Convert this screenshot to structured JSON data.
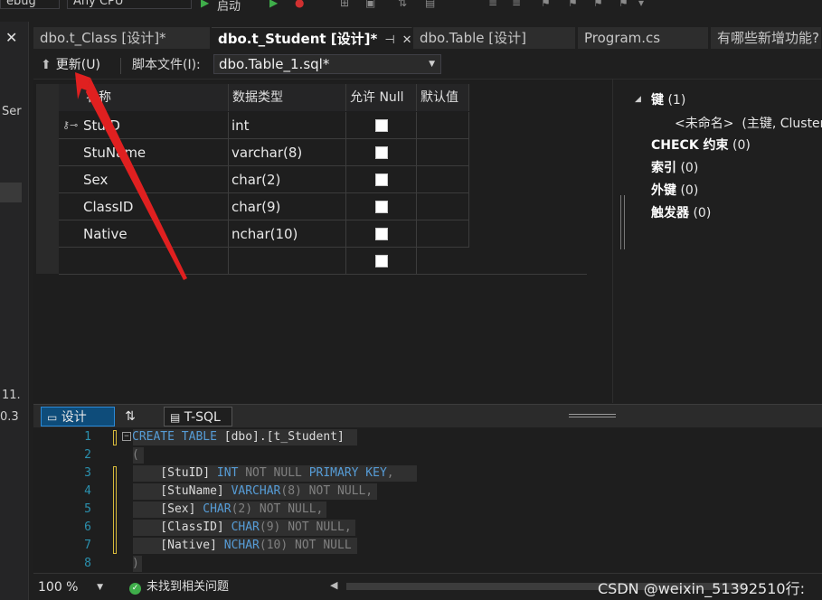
{
  "topbar": {
    "config_left": "ebug",
    "config_right": "Any CPU",
    "start_label": "启动"
  },
  "left_strip": {
    "close_glyph": "✕",
    "text_1": "Ser",
    "text_2": "11.",
    "text_3": "0.3"
  },
  "tabs": [
    {
      "label": "dbo.t_Class [设计]*"
    },
    {
      "label": "dbo.t_Student [设计]*",
      "active": true,
      "pin": "⊣",
      "close": "✕"
    },
    {
      "label": "dbo.Table [设计]"
    },
    {
      "label": "Program.cs"
    },
    {
      "label": "有哪些新增功能?"
    }
  ],
  "designer_toolbar": {
    "update_label": "更新(U)",
    "script_label": "脚本文件(I):",
    "script_file": "dbo.Table_1.sql*"
  },
  "grid": {
    "headers": [
      "名称",
      "数据类型",
      "允许 Null",
      "默认值"
    ],
    "rows": [
      {
        "name": "StuID",
        "type": "int",
        "allow_null": false,
        "primary_key": true
      },
      {
        "name": "StuName",
        "type": "varchar(8)",
        "allow_null": false
      },
      {
        "name": "Sex",
        "type": "char(2)",
        "allow_null": false
      },
      {
        "name": "ClassID",
        "type": "char(9)",
        "allow_null": false
      },
      {
        "name": "Native",
        "type": "nchar(10)",
        "allow_null": false
      },
      {
        "name": "",
        "type": "",
        "allow_null": false
      }
    ]
  },
  "properties": {
    "keys": "键 (1)",
    "keys_bold": "键",
    "keys_count": "(1)",
    "unnamed": "<未命名>",
    "unnamed_detail": "(主键, Clustered:",
    "check_bold": "CHECK 约束",
    "check_count": "(0)",
    "index_bold": "索引",
    "index_count": "(0)",
    "fk_bold": "外键",
    "fk_count": "(0)",
    "trigger_bold": "触发器",
    "trigger_count": "(0)"
  },
  "pane_tabs": {
    "design": "设计",
    "tsql": "T-SQL"
  },
  "editor": {
    "line_numbers": [
      "1",
      "2",
      "3",
      "4",
      "5",
      "6",
      "7",
      "8"
    ],
    "l1_kw1": "CREATE TABLE",
    "l1_rest": " [dbo].[t_Student]",
    "l2": "(",
    "l3_id": "    [StuID] ",
    "l3_kw": "INT",
    "l3_gr": " NOT NULL ",
    "l3_kw2": "PRIMARY KEY",
    "l3_end": ",",
    "l4_id": "    [StuName] ",
    "l4_kw": "VARCHAR",
    "l4_arg": "(8)",
    "l4_gr": " NOT NULL,",
    "l5_id": "    [Sex] ",
    "l5_kw": "CHAR",
    "l5_arg": "(2)",
    "l5_gr": " NOT NULL,",
    "l6_id": "    [ClassID] ",
    "l6_kw": "CHAR",
    "l6_arg": "(9)",
    "l6_gr": " NOT NULL,",
    "l7_id": "    [Native] ",
    "l7_kw": "NCHAR",
    "l7_arg": "(10)",
    "l7_gr": " NOT NULL",
    "l8": ")"
  },
  "statusbar": {
    "zoom": "100 %",
    "issues": "未找到相关问题",
    "watermark": "CSDN @weixin_51392510行:"
  },
  "colors": {
    "accent_blue": "#0e4c7a",
    "annotation_red": "#e02020",
    "keyword": "#569cd6"
  }
}
